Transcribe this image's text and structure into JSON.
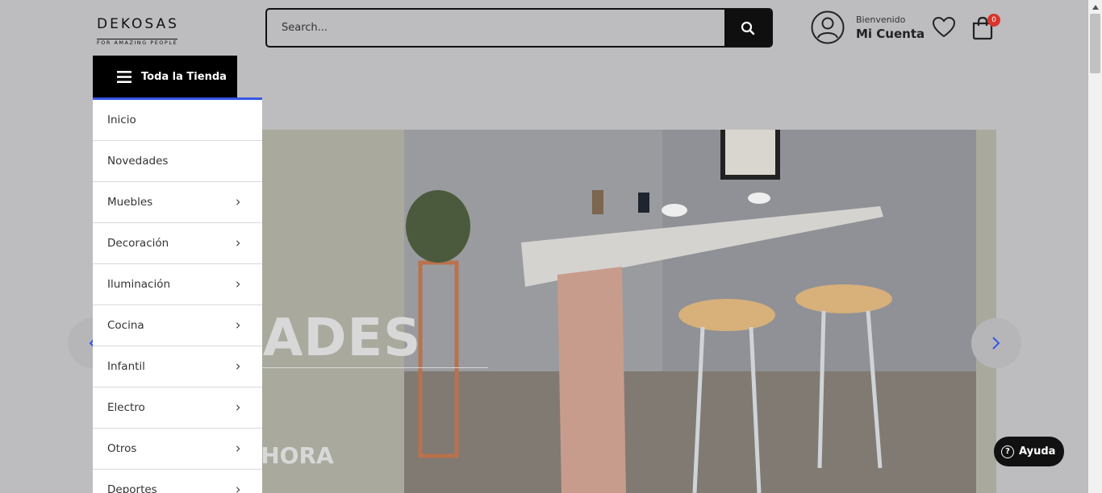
{
  "header": {
    "logo_main": "DEKOSAS",
    "logo_sub": "FOR AMAZING PEOPLE",
    "search_placeholder": "Search...",
    "welcome": "Bienvenido",
    "account_label": "Mi Cuenta",
    "cart_count": "0"
  },
  "category_button": {
    "label": "Toda la Tienda"
  },
  "menu": {
    "items": [
      {
        "label": "Inicio",
        "has_submenu": false
      },
      {
        "label": "Novedades",
        "has_submenu": false
      },
      {
        "label": "Muebles",
        "has_submenu": true
      },
      {
        "label": "Decoración",
        "has_submenu": true
      },
      {
        "label": "Iluminación",
        "has_submenu": true
      },
      {
        "label": "Cocina",
        "has_submenu": true
      },
      {
        "label": "Infantil",
        "has_submenu": true
      },
      {
        "label": "Electro",
        "has_submenu": true
      },
      {
        "label": "Otros",
        "has_submenu": true
      },
      {
        "label": "Deportes",
        "has_submenu": true
      }
    ]
  },
  "hero": {
    "title_visible": "EDADES",
    "cta_visible": "RAR AHORA"
  },
  "help": {
    "label": "Ayuda"
  },
  "colors": {
    "accent": "#3557e6",
    "badge": "#d9352b",
    "dark": "#000000"
  }
}
